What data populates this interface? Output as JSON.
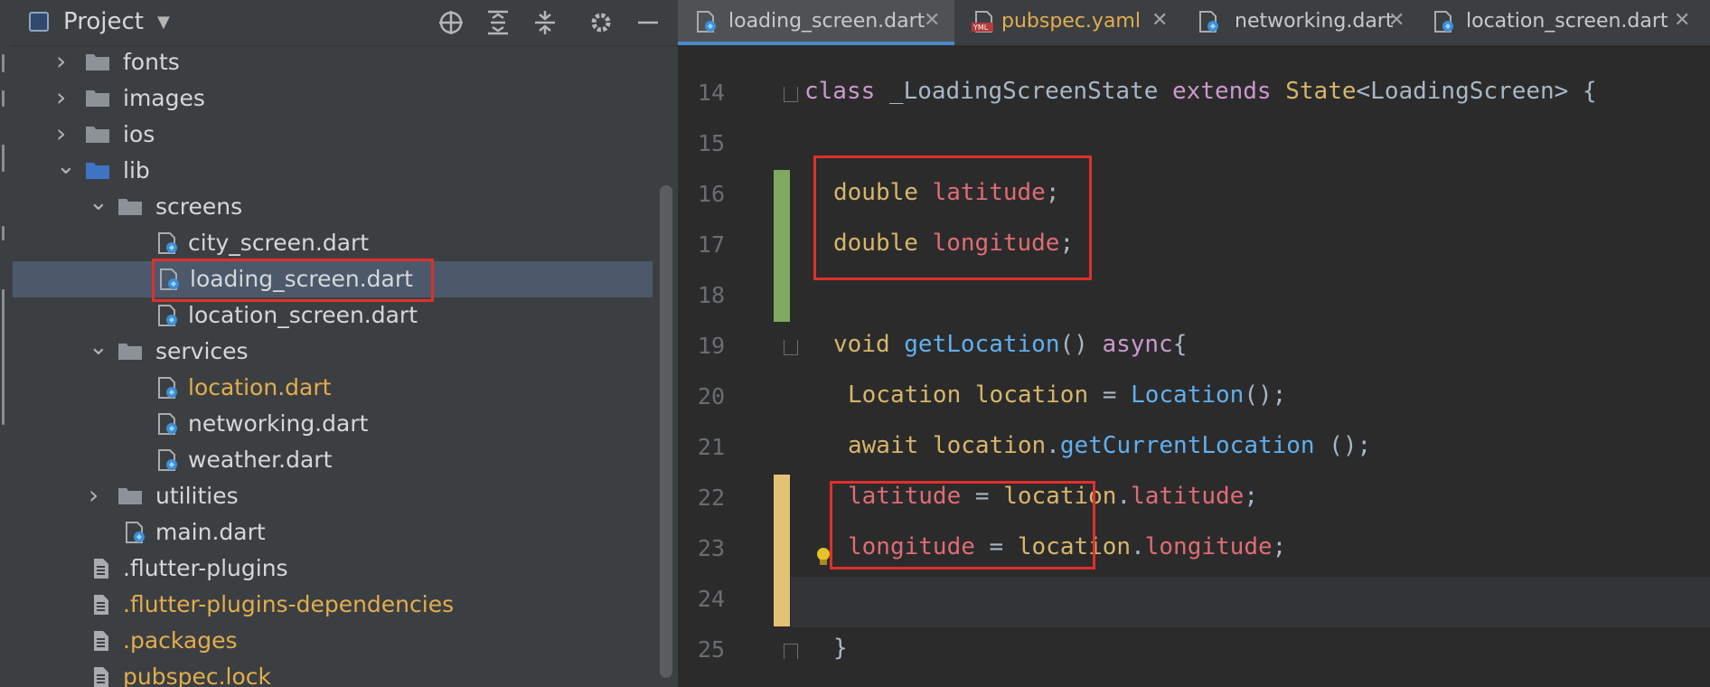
{
  "project_panel": {
    "title": "Project",
    "header_icons": [
      "target-icon",
      "expand-all-icon",
      "collapse-all-icon",
      "gear-icon",
      "minimize-icon"
    ],
    "tree": [
      {
        "label": "fonts",
        "type": "folder",
        "expanded": false
      },
      {
        "label": "images",
        "type": "folder",
        "expanded": false
      },
      {
        "label": "ios",
        "type": "folder",
        "expanded": false
      },
      {
        "label": "lib",
        "type": "folder",
        "expanded": true
      },
      {
        "label": "screens",
        "type": "folder",
        "expanded": true
      },
      {
        "label": "city_screen.dart",
        "type": "dart"
      },
      {
        "label": "loading_screen.dart",
        "type": "dart",
        "selected": true
      },
      {
        "label": "location_screen.dart",
        "type": "dart"
      },
      {
        "label": "services",
        "type": "folder",
        "expanded": true
      },
      {
        "label": "location.dart",
        "type": "dart",
        "modified": true
      },
      {
        "label": "networking.dart",
        "type": "dart"
      },
      {
        "label": "weather.dart",
        "type": "dart"
      },
      {
        "label": "utilities",
        "type": "folder",
        "expanded": false
      },
      {
        "label": "main.dart",
        "type": "dart"
      },
      {
        "label": ".flutter-plugins",
        "type": "file"
      },
      {
        "label": ".flutter-plugins-dependencies",
        "type": "file",
        "modified": true
      },
      {
        "label": ".packages",
        "type": "file",
        "modified": true
      },
      {
        "label": "pubspec.lock",
        "type": "file",
        "modified": true
      }
    ]
  },
  "tabs": [
    {
      "label": "loading_screen.dart",
      "active": true
    },
    {
      "label": "pubspec.yaml",
      "modified": true
    },
    {
      "label": "networking.dart"
    },
    {
      "label": "location_screen.dart"
    }
  ],
  "editor": {
    "line_numbers": [
      "14",
      "15",
      "16",
      "17",
      "18",
      "19",
      "20",
      "21",
      "22",
      "23",
      "24",
      "25"
    ],
    "lines": {
      "l14": {
        "kw_class": "class",
        "name": " _LoadingScreenState ",
        "kw_extends": "extends",
        "rest_type": " State",
        "rest": "<LoadingScreen> {"
      },
      "l16": {
        "type": "double",
        "field": "latitude",
        "end": ";"
      },
      "l17": {
        "type": "double",
        "field": "longitude",
        "end": ";"
      },
      "l19": {
        "type": "void",
        "fn": "getLocation",
        "mid": "() ",
        "kw": "async",
        "end": "{"
      },
      "l20": {
        "type": "Location",
        "var": " location",
        "eq": " = ",
        "ctor": "Location",
        "end": "();"
      },
      "l21": {
        "kw": "await",
        "obj": " location",
        "dot": ".",
        "fn": "getCurrentLocation",
        "end": " ();"
      },
      "l22": {
        "field": "latitude",
        "eq": " = ",
        "obj": "location",
        "dot": ".",
        "prop": "latitude",
        "end": ";"
      },
      "l23": {
        "field": "longitude",
        "eq": " = ",
        "obj": "location",
        "dot": ".",
        "prop": "longitude",
        "end": ";"
      },
      "l25": {
        "text": "}"
      }
    }
  },
  "colors": {
    "highlight_box": "#e0302b",
    "added_bar": "#7faa5f",
    "modified_bar": "#e2c275",
    "selection": "#4b596b"
  }
}
